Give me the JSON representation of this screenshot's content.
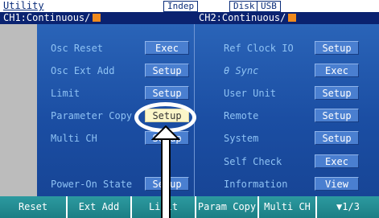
{
  "header": {
    "title": "Utility",
    "mode": "Indep",
    "disk": "Disk",
    "usb": "USB",
    "ch1": "CH1:Continuous/",
    "ch2": "CH2:Continuous/"
  },
  "left_column": [
    {
      "label": "Osc Reset",
      "button": "Exec"
    },
    {
      "label": "Osc Ext Add",
      "button": "Setup"
    },
    {
      "label": "Limit",
      "button": "Setup"
    },
    {
      "label": "Parameter Copy",
      "button": "Setup",
      "selected": true
    },
    {
      "label": "Multi CH",
      "button": "Setup"
    },
    {
      "label": "Power-On State",
      "button": "Setup"
    }
  ],
  "right_column": [
    {
      "label": "Ref Clock IO",
      "button": "Setup"
    },
    {
      "label": "θ Sync",
      "button": "Exec"
    },
    {
      "label": "User Unit",
      "button": "Setup"
    },
    {
      "label": "Remote",
      "button": "Setup"
    },
    {
      "label": "System",
      "button": "Setup"
    },
    {
      "label": "Self Check",
      "button": "Exec"
    },
    {
      "label": "Information",
      "button": "View"
    }
  ],
  "softkeys": [
    "Reset",
    "Ext Add",
    "Limit",
    "Param Copy",
    "Multi CH",
    "▼1/3"
  ],
  "colors": {
    "header_bar": "#0a2270",
    "panel": "#1f55a8",
    "label_text": "#8ec2f4",
    "button": "#4a7fd0",
    "selected_button": "#fbf6c9",
    "softkey": "#1f858b",
    "channel_indicator": "#f08a1e"
  }
}
